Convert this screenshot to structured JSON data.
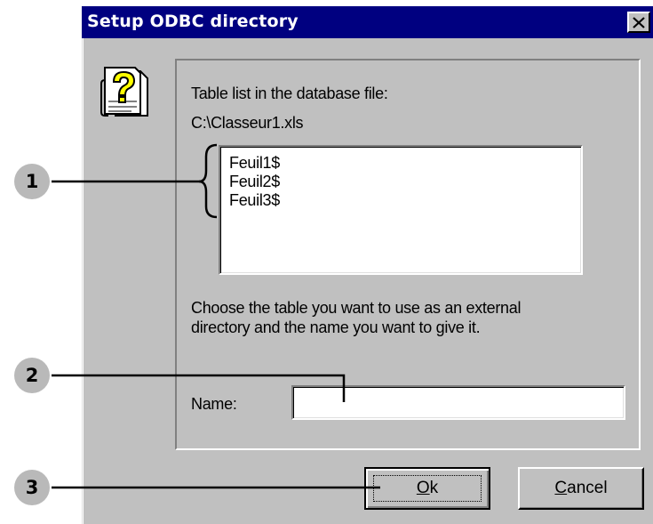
{
  "window": {
    "title": "Setup ODBC directory"
  },
  "icons": {
    "close": "close-icon",
    "help": "help-question-icon"
  },
  "group": {
    "table_list_label": "Table list in the database file:",
    "file_path": "C:\\Classeur1.xls",
    "tables": [
      "Feuil1$",
      "Feuil2$",
      "Feuil3$"
    ],
    "instruction_line1": "Choose the table you want to use as an external",
    "instruction_line2": "directory and the name you want to give it.",
    "name_label": "Name:",
    "name_value": ""
  },
  "buttons": {
    "ok_mnemonic": "O",
    "ok_rest": "k",
    "cancel_mnemonic": "C",
    "cancel_rest": "ancel"
  },
  "callouts": [
    "1",
    "2",
    "3"
  ],
  "colors": {
    "titlebar": "#000080",
    "dialog_face": "#c0c0c0",
    "callout_badge": "#b9b9b9"
  }
}
